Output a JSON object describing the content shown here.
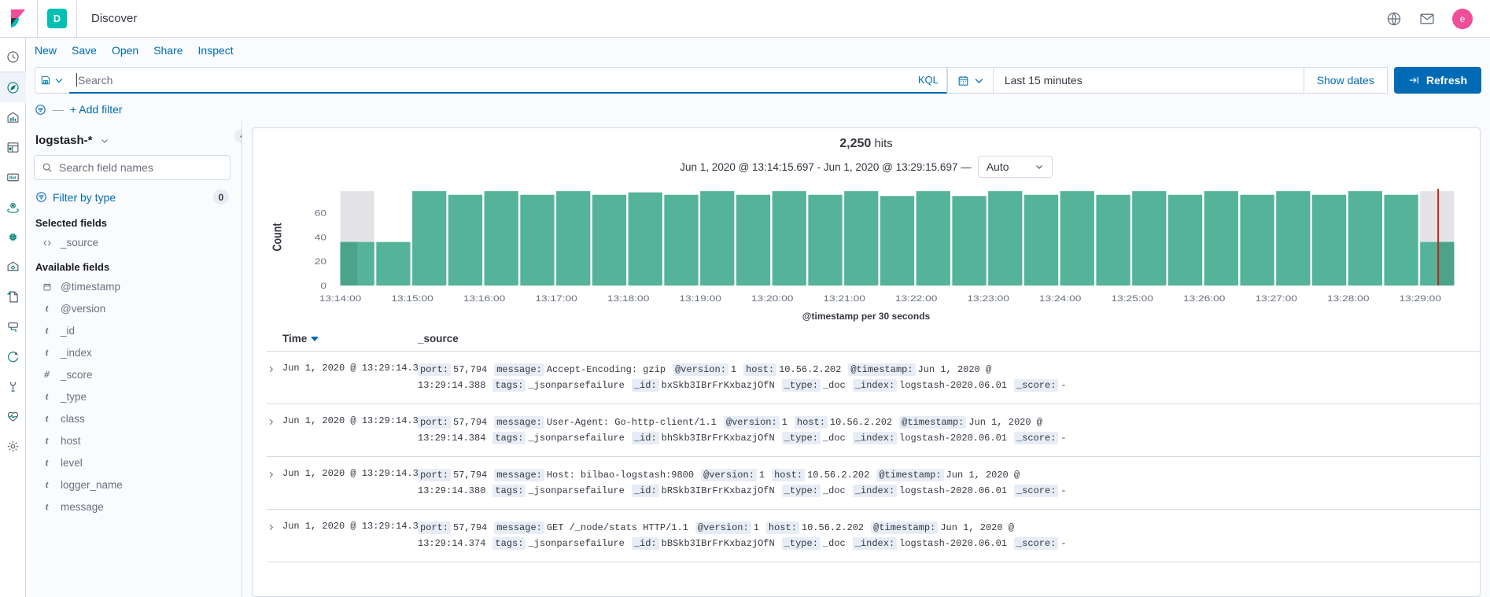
{
  "header": {
    "app_badge": "D",
    "app_title": "Discover",
    "icons": [
      "globe-icon",
      "mail-icon"
    ],
    "avatar_initial": "e",
    "avatar_color": "#f04e98",
    "badge_color": "#00bfb3"
  },
  "nav_rail": {
    "items": [
      {
        "name": "recently-viewed",
        "icon": "clock-icon",
        "active": false
      },
      {
        "name": "discover",
        "icon": "compass-icon",
        "active": true
      },
      {
        "name": "visualize",
        "icon": "bar-chart-icon",
        "active": false
      },
      {
        "name": "dashboard",
        "icon": "dashboard-icon",
        "active": false
      },
      {
        "name": "canvas",
        "icon": "canvas-icon",
        "active": false
      },
      {
        "name": "maps",
        "icon": "map-marker-icon",
        "active": false
      },
      {
        "name": "machine-learning",
        "icon": "ml-icon",
        "active": false
      },
      {
        "name": "infrastructure",
        "icon": "infrastructure-icon",
        "active": false
      },
      {
        "name": "logs",
        "icon": "logs-icon",
        "active": false
      },
      {
        "name": "apm",
        "icon": "apm-icon",
        "active": false
      },
      {
        "name": "uptime",
        "icon": "uptime-icon",
        "active": false
      },
      {
        "name": "dev-tools",
        "icon": "wrench-icon",
        "active": false
      },
      {
        "name": "stack-monitoring",
        "icon": "heartbeat-icon",
        "active": false
      },
      {
        "name": "management",
        "icon": "gear-icon",
        "active": false
      }
    ]
  },
  "menu": {
    "items": [
      "New",
      "Save",
      "Open",
      "Share",
      "Inspect"
    ]
  },
  "query_bar": {
    "save_icon": "save-icon",
    "search_value": "",
    "search_placeholder": "Search",
    "language": "KQL",
    "calendar_icon": "calendar-icon",
    "time_range": "Last 15 minutes",
    "show_dates": "Show dates",
    "refresh_label": "Refresh",
    "refresh_color": "#006bb4"
  },
  "filter_bar": {
    "filter_icon": "filter-icon",
    "dash": "—",
    "add_filter": "+ Add filter"
  },
  "sidebar": {
    "index_pattern": "logstash-*",
    "field_search_placeholder": "Search field names",
    "field_search_value": "",
    "filter_by_type_label": "Filter by type",
    "filter_by_type_count": "0",
    "selected_fields_title": "Selected fields",
    "selected_fields": [
      {
        "name": "_source",
        "type": "source"
      }
    ],
    "available_fields_title": "Available fields",
    "available_fields": [
      {
        "name": "@timestamp",
        "type": "date"
      },
      {
        "name": "@version",
        "type": "string"
      },
      {
        "name": "_id",
        "type": "string"
      },
      {
        "name": "_index",
        "type": "string"
      },
      {
        "name": "_score",
        "type": "number"
      },
      {
        "name": "_type",
        "type": "string"
      },
      {
        "name": "class",
        "type": "string"
      },
      {
        "name": "host",
        "type": "string"
      },
      {
        "name": "level",
        "type": "string"
      },
      {
        "name": "logger_name",
        "type": "string"
      },
      {
        "name": "message",
        "type": "string"
      }
    ]
  },
  "histogram": {
    "hits_count": "2,250",
    "hits_label": "hits",
    "range_text": "Jun 1, 2020 @ 13:14:15.697 - Jun 1, 2020 @ 13:29:15.697 —",
    "interval": "Auto"
  },
  "chart_data": {
    "type": "bar",
    "title": "",
    "xlabel": "@timestamp per 30 seconds",
    "ylabel": "Count",
    "ylim": [
      0,
      80
    ],
    "yticks": [
      0,
      20,
      40,
      60
    ],
    "grid": false,
    "bar_color": "#54b399",
    "partial_overlay_color": "#e3e3e7",
    "current_time_marker_color": "#bd271e",
    "xticks": [
      "13:14:00",
      "13:15:00",
      "13:16:00",
      "13:17:00",
      "13:18:00",
      "13:19:00",
      "13:20:00",
      "13:21:00",
      "13:22:00",
      "13:23:00",
      "13:24:00",
      "13:25:00",
      "13:26:00",
      "13:27:00",
      "13:28:00",
      "13:29:00"
    ],
    "categories": [
      "13:14:00",
      "13:14:30",
      "13:15:00",
      "13:15:30",
      "13:16:00",
      "13:16:30",
      "13:17:00",
      "13:17:30",
      "13:18:00",
      "13:18:30",
      "13:19:00",
      "13:19:30",
      "13:20:00",
      "13:20:30",
      "13:21:00",
      "13:21:30",
      "13:22:00",
      "13:22:30",
      "13:23:00",
      "13:23:30",
      "13:24:00",
      "13:24:30",
      "13:25:00",
      "13:25:30",
      "13:26:00",
      "13:26:30",
      "13:27:00",
      "13:27:30",
      "13:28:00",
      "13:28:30",
      "13:29:00"
    ],
    "values": [
      36,
      36,
      78,
      75,
      78,
      75,
      78,
      75,
      77,
      75,
      78,
      75,
      78,
      75,
      78,
      74,
      78,
      74,
      78,
      75,
      78,
      75,
      78,
      75,
      78,
      75,
      78,
      75,
      78,
      75,
      36
    ],
    "partial_bins": [
      0,
      30
    ]
  },
  "doc_table": {
    "columns": [
      "Time",
      "_source"
    ],
    "sort_column": "Time",
    "sort_direction": "desc",
    "rows": [
      {
        "time": "Jun 1, 2020 @ 13:29:14.388",
        "fields": [
          {
            "key": "port:",
            "value": "57,794"
          },
          {
            "key": "message:",
            "value": "Accept-Encoding: gzip"
          },
          {
            "key": "@version:",
            "value": "1"
          },
          {
            "key": "host:",
            "value": "10.56.2.202"
          },
          {
            "key": "@timestamp:",
            "value": "Jun 1, 2020 @ 13:29:14.388"
          },
          {
            "key": "tags:",
            "value": "_jsonparsefailure"
          },
          {
            "key": "_id:",
            "value": "bxSkb3IBrFrKxbazjOfN"
          },
          {
            "key": "_type:",
            "value": "_doc"
          },
          {
            "key": "_index:",
            "value": "logstash-2020.06.01"
          },
          {
            "key": "_score:",
            "value": "-"
          }
        ]
      },
      {
        "time": "Jun 1, 2020 @ 13:29:14.384",
        "fields": [
          {
            "key": "port:",
            "value": "57,794"
          },
          {
            "key": "message:",
            "value": "User-Agent: Go-http-client/1.1"
          },
          {
            "key": "@version:",
            "value": "1"
          },
          {
            "key": "host:",
            "value": "10.56.2.202"
          },
          {
            "key": "@timestamp:",
            "value": "Jun 1, 2020 @ 13:29:14.384"
          },
          {
            "key": "tags:",
            "value": "_jsonparsefailure"
          },
          {
            "key": "_id:",
            "value": "bhSkb3IBrFrKxbazjOfN"
          },
          {
            "key": "_type:",
            "value": "_doc"
          },
          {
            "key": "_index:",
            "value": "logstash-2020.06.01"
          },
          {
            "key": "_score:",
            "value": "-"
          }
        ]
      },
      {
        "time": "Jun 1, 2020 @ 13:29:14.380",
        "fields": [
          {
            "key": "port:",
            "value": "57,794"
          },
          {
            "key": "message:",
            "value": "Host: bilbao-logstash:9800"
          },
          {
            "key": "@version:",
            "value": "1"
          },
          {
            "key": "host:",
            "value": "10.56.2.202"
          },
          {
            "key": "@timestamp:",
            "value": "Jun 1, 2020 @ 13:29:14.380"
          },
          {
            "key": "tags:",
            "value": "_jsonparsefailure"
          },
          {
            "key": "_id:",
            "value": "bRSkb3IBrFrKxbazjOfN"
          },
          {
            "key": "_type:",
            "value": "_doc"
          },
          {
            "key": "_index:",
            "value": "logstash-2020.06.01"
          },
          {
            "key": "_score:",
            "value": "-"
          }
        ]
      },
      {
        "time": "Jun 1, 2020 @ 13:29:14.374",
        "fields": [
          {
            "key": "port:",
            "value": "57,794"
          },
          {
            "key": "message:",
            "value": "GET /_node/stats HTTP/1.1"
          },
          {
            "key": "@version:",
            "value": "1"
          },
          {
            "key": "host:",
            "value": "10.56.2.202"
          },
          {
            "key": "@timestamp:",
            "value": "Jun 1, 2020 @ 13:29:14.374"
          },
          {
            "key": "tags:",
            "value": "_jsonparsefailure"
          },
          {
            "key": "_id:",
            "value": "bBSkb3IBrFrKxbazjOfN"
          },
          {
            "key": "_type:",
            "value": "_doc"
          },
          {
            "key": "_index:",
            "value": "logstash-2020.06.01"
          },
          {
            "key": "_score:",
            "value": "-"
          }
        ]
      }
    ]
  }
}
